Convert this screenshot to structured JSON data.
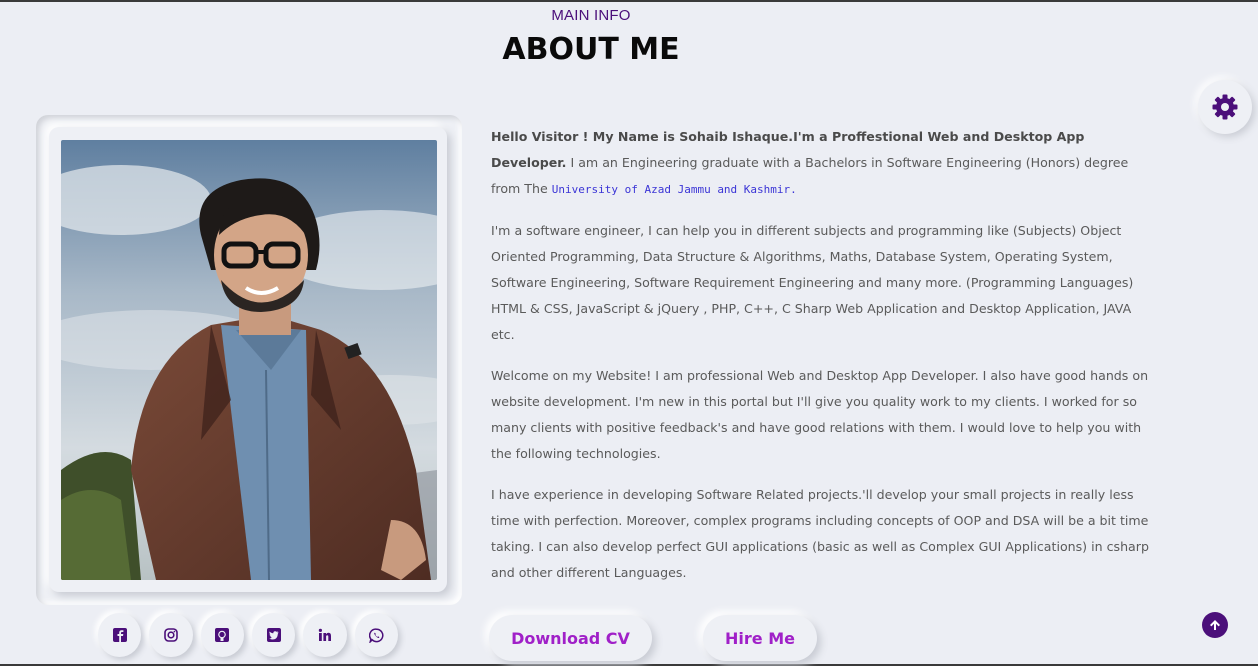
{
  "header": {
    "subtitle": "MAIN INFO",
    "title": "ABOUT ME"
  },
  "about": {
    "intro_bold": "Hello Visitor ! My Name is Sohaib Ishaque.I'm a Proffestional Web and Desktop App Developer.",
    "intro_rest": " I am an Engineering graduate with a Bachelors in Software Engineering (Honors) degree from The ",
    "university": "University of Azad Jammu and Kashmir.",
    "p2": "I'm a software engineer, I can help you in different subjects and programming like (Subjects) Object Oriented Programming, Data Structure & Algorithms, Maths, Database System, Operating System, Software Engineering, Software Requirement Engineering and many more. (Programming Languages) HTML & CSS, JavaScript & jQuery , PHP, C++, C Sharp Web Application and Desktop Application, JAVA etc.",
    "p3": "Welcome on my Website! I am professional Web and Desktop App Developer. I also have good hands on website development. I'm new in this portal but I'll give you quality work to my clients. I worked for so many clients with positive feedback's and have good relations with them. I would love to help you with the following technologies.",
    "p4": "I have experience in developing Software Related projects.'ll develop your small projects in really less time with perfection. Moreover, complex programs including concepts of OOP and DSA will be a bit time taking. I can also develop perfect GUI applications (basic as well as Complex GUI Applications) in csharp and other different Languages."
  },
  "buttons": {
    "download_cv": "Download CV",
    "hire_me": "Hire Me"
  },
  "socials": [
    {
      "icon": "facebook-icon"
    },
    {
      "icon": "instagram-icon"
    },
    {
      "icon": "github-icon"
    },
    {
      "icon": "twitter-icon"
    },
    {
      "icon": "linkedin-icon"
    },
    {
      "icon": "whatsapp-icon"
    }
  ],
  "colors": {
    "accent": "#4b0f7a",
    "button_text": "#a020c8",
    "link": "#3b35d6",
    "background": "#eceef4"
  }
}
